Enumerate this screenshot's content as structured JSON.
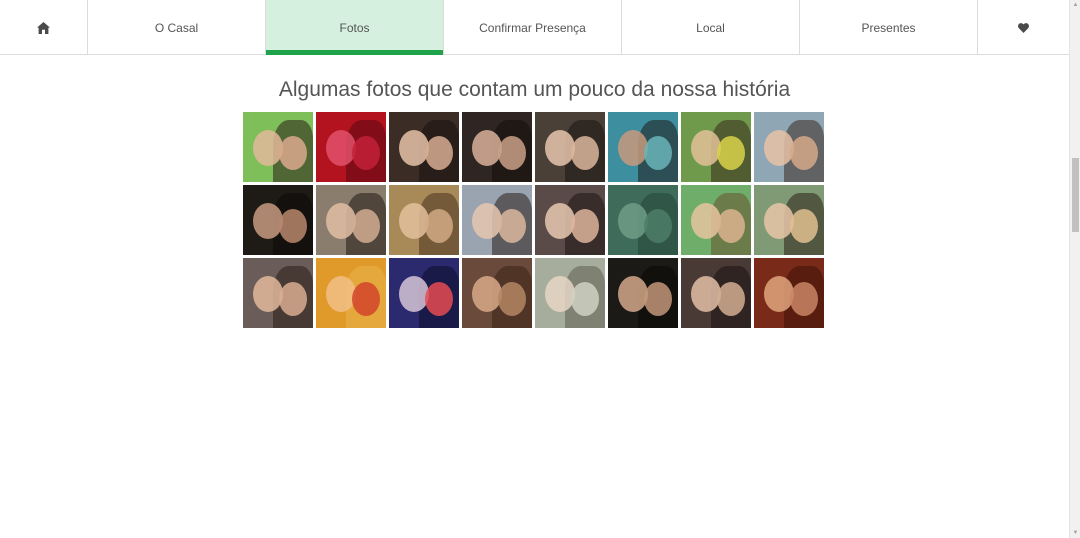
{
  "nav": {
    "home_icon": "home-icon",
    "tabs": [
      {
        "label": "O Casal"
      },
      {
        "label": "Fotos",
        "active": true
      },
      {
        "label": "Confirmar Presença"
      },
      {
        "label": "Local"
      },
      {
        "label": "Presentes"
      }
    ],
    "heart_icon": "heart-icon",
    "active_color": "#1ea24a",
    "active_bg": "#d5f0df"
  },
  "gallery": {
    "title": "Algumas fotos que contam um pouco da nossa história",
    "photos": [
      {
        "bg": "#7fbf5a",
        "face": "#e2b89a",
        "face2": "#d9a98c",
        "hair": "#2a1e17"
      },
      {
        "bg": "#b3121f",
        "face": "#e0516a",
        "face2": "#c2213a",
        "hair": "#5a0a12"
      },
      {
        "bg": "#3b2c26",
        "face": "#e6c3a8",
        "face2": "#d7ad92",
        "hair": "#1b120e"
      },
      {
        "bg": "#2f2623",
        "face": "#d9b29a",
        "face2": "#caa086",
        "hair": "#140d0b"
      },
      {
        "bg": "#4a4038",
        "face": "#e8c6ad",
        "face2": "#dbb69b",
        "hair": "#1c1410"
      },
      {
        "bg": "#3d8fa0",
        "face": "#c79a7d",
        "face2": "#6ab5b8",
        "hair": "#1f1a18"
      },
      {
        "bg": "#6f9a4c",
        "face": "#e3bf96",
        "face2": "#d8d24a",
        "hair": "#3b2a1c"
      },
      {
        "bg": "#8fa7b5",
        "face": "#e7c2a5",
        "face2": "#d6a988",
        "hair": "#3a2a20"
      },
      {
        "bg": "#1e1a16",
        "face": "#c79b80",
        "face2": "#b8876d",
        "hair": "#0c0907"
      },
      {
        "bg": "#8a7d6e",
        "face": "#e0bea4",
        "face2": "#d2ad92",
        "hair": "#231a14"
      },
      {
        "bg": "#a88a58",
        "face": "#e3bf9c",
        "face2": "#d2aa85",
        "hair": "#4a3320"
      },
      {
        "bg": "#9aa3b0",
        "face": "#e6c8b0",
        "face2": "#dbb79e",
        "hair": "#2a1f18"
      },
      {
        "bg": "#5a4a48",
        "face": "#e9c9b2",
        "face2": "#ddb59c",
        "hair": "#1e1512"
      },
      {
        "bg": "#3e6b5a",
        "face": "#6f9c86",
        "face2": "#4c7d6a",
        "hair": "#24463a"
      },
      {
        "bg": "#6fae6a",
        "face": "#e6c49f",
        "face2": "#dcb48e",
        "hair": "#6a5230"
      },
      {
        "bg": "#7f9a74",
        "face": "#e7c5a8",
        "face2": "#e0c090",
        "hair": "#2b2018"
      },
      {
        "bg": "#6a5c58",
        "face": "#e2b99b",
        "face2": "#d9ad8f",
        "hair": "#2a1f1a"
      },
      {
        "bg": "#e09a2a",
        "face": "#f1bf86",
        "face2": "#d2452b",
        "hair": "#e8b44a"
      },
      {
        "bg": "#2b2a6e",
        "face": "#d7c5d8",
        "face2": "#e84b52",
        "hair": "#0d0c2a"
      },
      {
        "bg": "#6a4a3a",
        "face": "#d8a988",
        "face2": "#b48665",
        "hair": "#3a2418"
      },
      {
        "bg": "#a7ad9c",
        "face": "#e6d6c6",
        "face2": "#cfd2c2",
        "hair": "#5e5e52"
      },
      {
        "bg": "#1c1a16",
        "face": "#d3a88a",
        "face2": "#c39679",
        "hair": "#0b0907"
      },
      {
        "bg": "#4a3a36",
        "face": "#e3c0a6",
        "face2": "#d2ae90",
        "hair": "#1a1311"
      },
      {
        "bg": "#7a2a18",
        "face": "#e0a47e",
        "face2": "#c98564",
        "hair": "#3c1208"
      }
    ]
  },
  "scrollbar": {
    "up_icon": "scroll-up-arrow-icon",
    "down_icon": "scroll-down-arrow-icon"
  }
}
